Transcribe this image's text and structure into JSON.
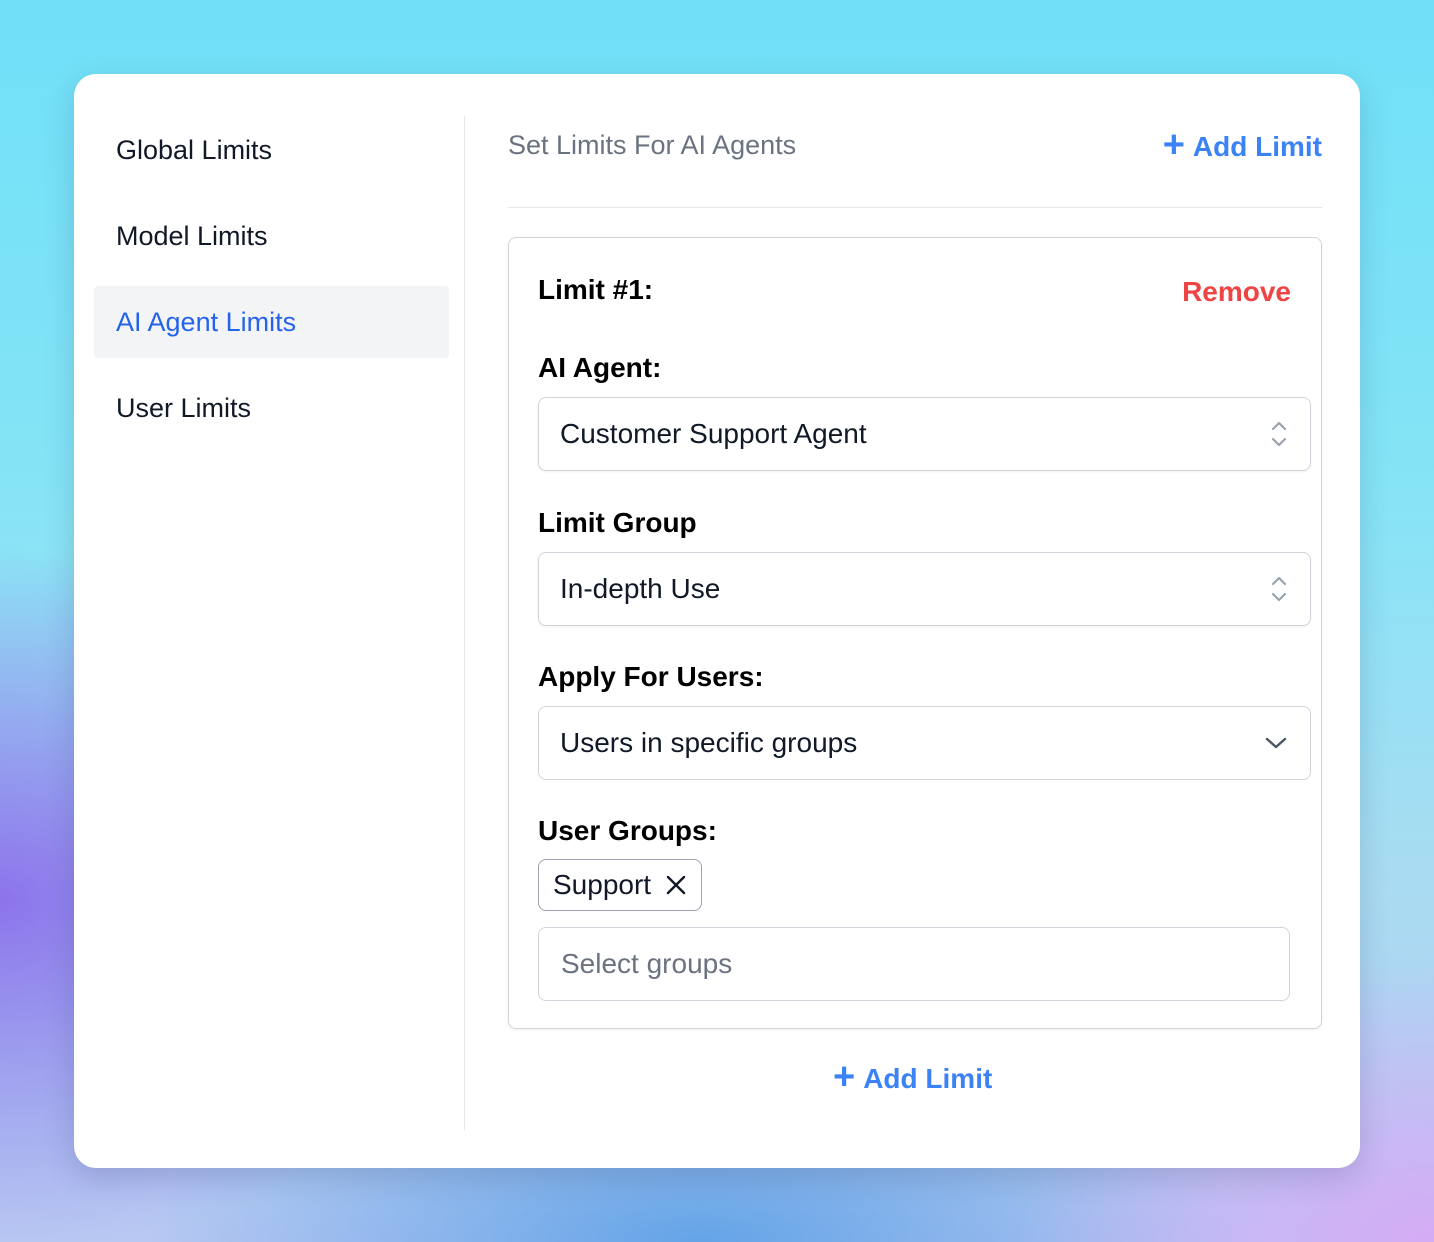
{
  "sidebar": {
    "items": [
      {
        "label": "Global Limits",
        "active": false
      },
      {
        "label": "Model Limits",
        "active": false
      },
      {
        "label": "AI Agent Limits",
        "active": true
      },
      {
        "label": "User Limits",
        "active": false
      }
    ]
  },
  "main": {
    "title": "Set Limits For AI Agents",
    "add_limit_label": "Add Limit",
    "add_icon": "plus-icon",
    "limits": [
      {
        "title": "Limit #1:",
        "remove_label": "Remove",
        "agent_label": "AI Agent:",
        "agent_value": "Customer Support Agent",
        "group_label": "Limit Group",
        "group_value": "In-depth Use",
        "apply_label": "Apply For Users:",
        "apply_value": "Users in specific groups",
        "user_groups_label": "User Groups:",
        "user_groups": [
          "Support"
        ],
        "groups_placeholder": "Select groups"
      }
    ]
  },
  "colors": {
    "accent": "#3b82f6",
    "active_nav": "#2563eb",
    "danger": "#ef4444",
    "muted": "#6b7280"
  }
}
